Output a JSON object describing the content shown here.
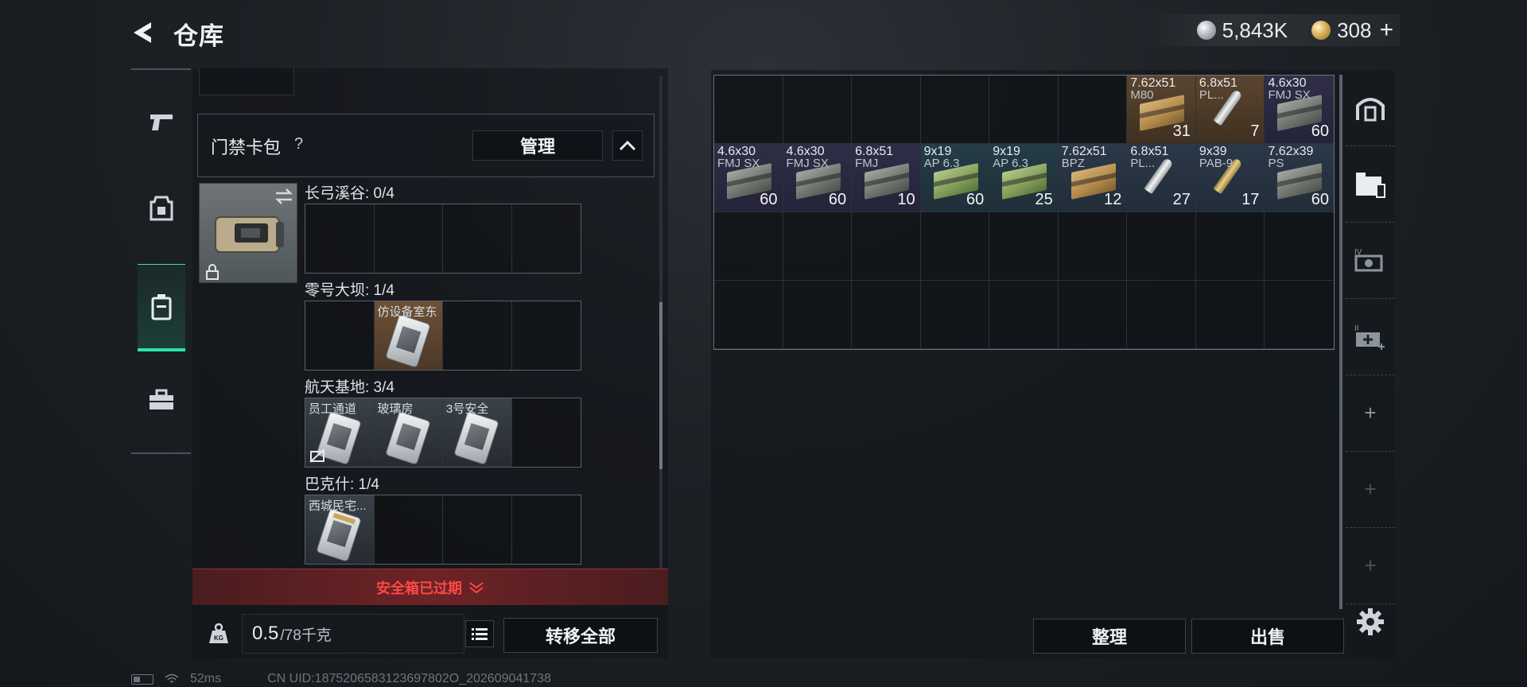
{
  "header": {
    "title": "仓库",
    "currency_silver": "5,843K",
    "currency_gold": "308",
    "add_label": "+"
  },
  "left_nav": {
    "items": [
      "weapon-icon",
      "gear-icon",
      "storage-icon",
      "toolbox-icon"
    ],
    "active_index": 2
  },
  "card_pack": {
    "title": "门禁卡包",
    "help": "?",
    "manage_label": "管理"
  },
  "maps": [
    {
      "label": "长弓溪谷: 0/4",
      "slots": [
        "",
        "",
        "",
        ""
      ]
    },
    {
      "label": "零号大坝: 1/4",
      "slots": [
        "",
        "仿设备室东",
        "",
        ""
      ]
    },
    {
      "label": "航天基地: 3/4",
      "slots": [
        "员工通道",
        "玻璃房",
        "3号安全",
        ""
      ]
    },
    {
      "label": "巴克什: 1/4",
      "slots": [
        "西城民宅...",
        "",
        "",
        ""
      ]
    }
  ],
  "expired_banner": "安全箱已过期",
  "footer": {
    "weight_current": "0.5",
    "weight_capacity": "/78千克",
    "transfer_all_label": "转移全部"
  },
  "grid_items": [
    {
      "row": 0,
      "col": 6,
      "caliber": "7.62x51",
      "sub": "M80",
      "count": "31",
      "color": "brown",
      "icon": "tan"
    },
    {
      "row": 0,
      "col": 7,
      "caliber": "6.8x51",
      "sub": "PL...",
      "count": "7",
      "color": "brown",
      "icon": "bullet"
    },
    {
      "row": 0,
      "col": 8,
      "caliber": "4.6x30",
      "sub": "FMJ SX",
      "count": "60",
      "color": "purple",
      "icon": "gray"
    },
    {
      "row": 1,
      "col": 0,
      "caliber": "4.6x30",
      "sub": "FMJ SX",
      "count": "60",
      "color": "purple",
      "icon": "gray"
    },
    {
      "row": 1,
      "col": 1,
      "caliber": "4.6x30",
      "sub": "FMJ SX",
      "count": "60",
      "color": "purple",
      "icon": "gray"
    },
    {
      "row": 1,
      "col": 2,
      "caliber": "6.8x51",
      "sub": "FMJ",
      "count": "10",
      "color": "purple",
      "icon": "gray"
    },
    {
      "row": 1,
      "col": 3,
      "caliber": "9x19",
      "sub": "AP 6.3",
      "count": "60",
      "color": "teal",
      "icon": "green"
    },
    {
      "row": 1,
      "col": 4,
      "caliber": "9x19",
      "sub": "AP 6.3",
      "count": "25",
      "color": "teal",
      "icon": "green"
    },
    {
      "row": 1,
      "col": 5,
      "caliber": "7.62x51",
      "sub": "BPZ",
      "count": "12",
      "color": "blue",
      "icon": "tan"
    },
    {
      "row": 1,
      "col": 6,
      "caliber": "6.8x51",
      "sub": "PL...",
      "count": "27",
      "color": "blue",
      "icon": "bullet"
    },
    {
      "row": 1,
      "col": 7,
      "caliber": "9x39",
      "sub": "PAB-9",
      "count": "17",
      "color": "blue",
      "icon": "bullet-gold"
    },
    {
      "row": 1,
      "col": 8,
      "caliber": "7.62x39",
      "sub": "PS",
      "count": "60",
      "color": "blue",
      "icon": "gray"
    }
  ],
  "right_actions": {
    "sort_label": "整理",
    "sell_label": "出售"
  },
  "right_tabs": [
    "garage-icon",
    "storage-box-icon",
    "case-icon",
    "medkit-icon",
    "+",
    "+",
    "+"
  ],
  "status_bar": {
    "ping": "52ms",
    "uid": "CN UID:1875206583123697802O_202609041738"
  }
}
